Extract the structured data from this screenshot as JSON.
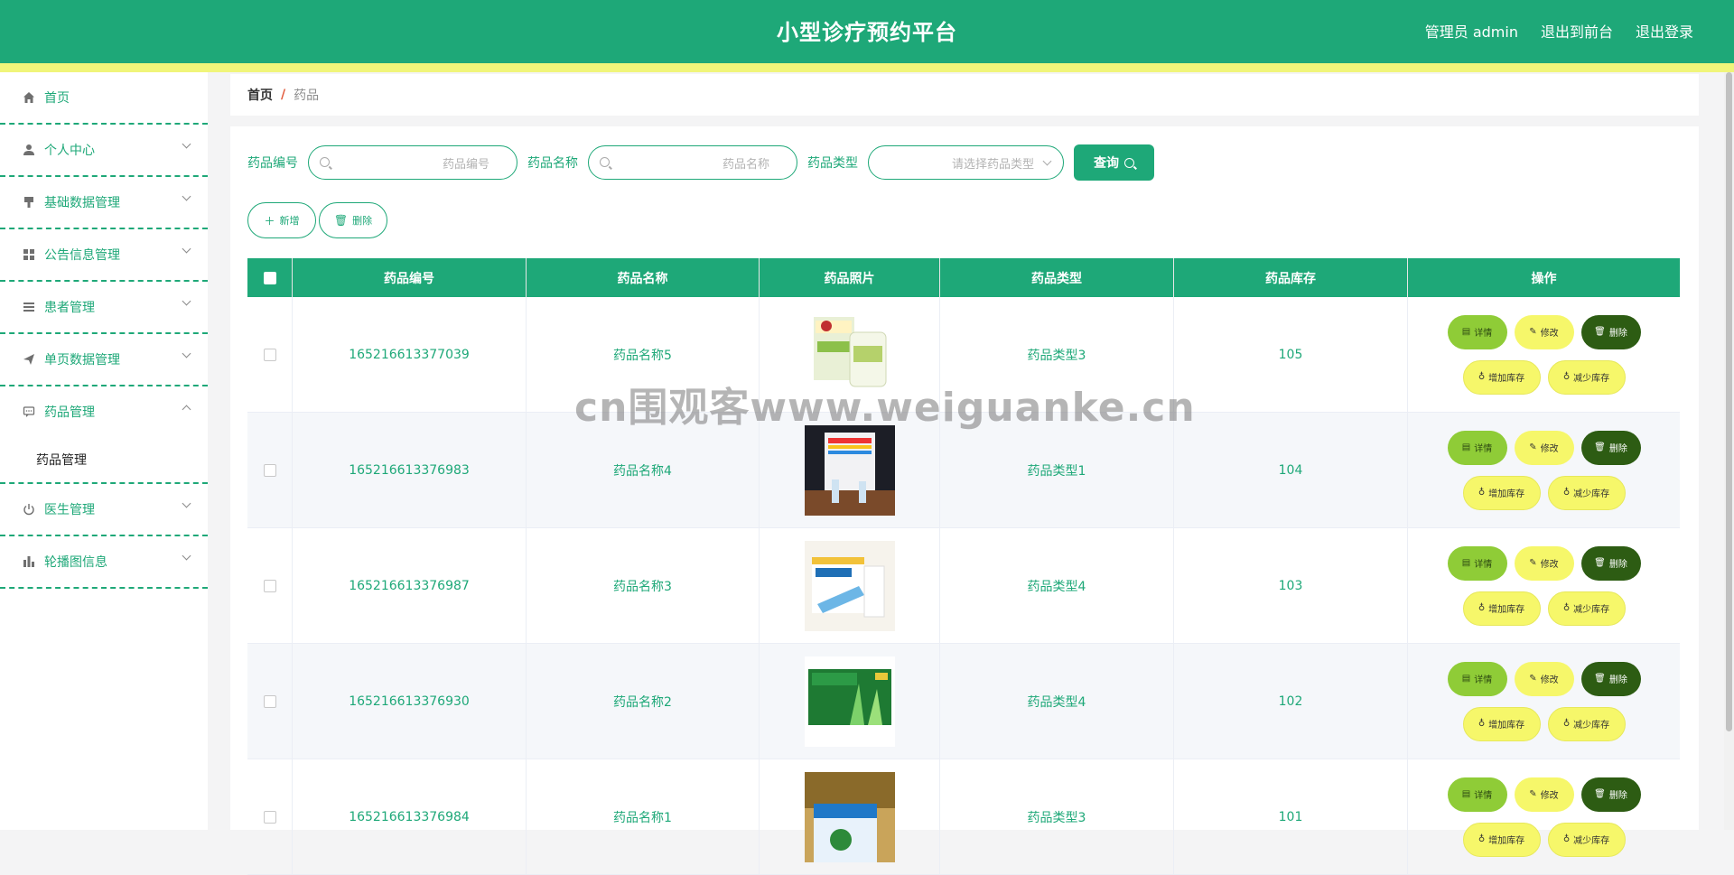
{
  "header": {
    "title": "小型诊疗预约平台",
    "admin": "管理员 admin",
    "front": "退出到前台",
    "logout": "退出登录"
  },
  "sidebar": {
    "items": [
      {
        "label": "首页",
        "icon": "home-icon"
      },
      {
        "label": "个人中心",
        "icon": "user-icon"
      },
      {
        "label": "基础数据管理",
        "icon": "brush-icon"
      },
      {
        "label": "公告信息管理",
        "icon": "grid-icon"
      },
      {
        "label": "患者管理",
        "icon": "list-icon"
      },
      {
        "label": "单页数据管理",
        "icon": "send-icon"
      },
      {
        "label": "药品管理",
        "icon": "chat-icon"
      },
      {
        "label": "医生管理",
        "icon": "power-icon"
      },
      {
        "label": "轮播图信息",
        "icon": "bar-chart-icon"
      }
    ],
    "sub_item": "药品管理"
  },
  "breadcrumb": {
    "home": "首页",
    "sep": "/",
    "current": "药品"
  },
  "search": {
    "code_label": "药品编号",
    "code_placeholder": "药品编号",
    "name_label": "药品名称",
    "name_placeholder": "药品名称",
    "type_label": "药品类型",
    "type_placeholder": "请选择药品类型",
    "query": "查询"
  },
  "actions": {
    "add": "新增",
    "delete": "删除"
  },
  "table": {
    "headers": [
      "药品编号",
      "药品名称",
      "药品照片",
      "药品类型",
      "药品库存",
      "操作"
    ],
    "rows": [
      {
        "code": "165216613377039",
        "name": "药品名称5",
        "type": "药品类型3",
        "stock": "105"
      },
      {
        "code": "165216613376983",
        "name": "药品名称4",
        "type": "药品类型1",
        "stock": "104"
      },
      {
        "code": "165216613376987",
        "name": "药品名称3",
        "type": "药品类型4",
        "stock": "103"
      },
      {
        "code": "165216613376930",
        "name": "药品名称2",
        "type": "药品类型4",
        "stock": "102"
      },
      {
        "code": "165216613376984",
        "name": "药品名称1",
        "type": "药品类型3",
        "stock": "101"
      }
    ],
    "ops": {
      "detail": "详情",
      "edit": "修改",
      "delete": "删除",
      "increase": "增加库存",
      "decrease": "减少库存"
    }
  },
  "watermark": "cn围观客www.weiguanke.cn",
  "colors": {
    "primary": "#1ea878",
    "accent_yellow": "#f6f76a",
    "detail_green": "#8fcc37",
    "delete_dark": "#2d5c13"
  }
}
